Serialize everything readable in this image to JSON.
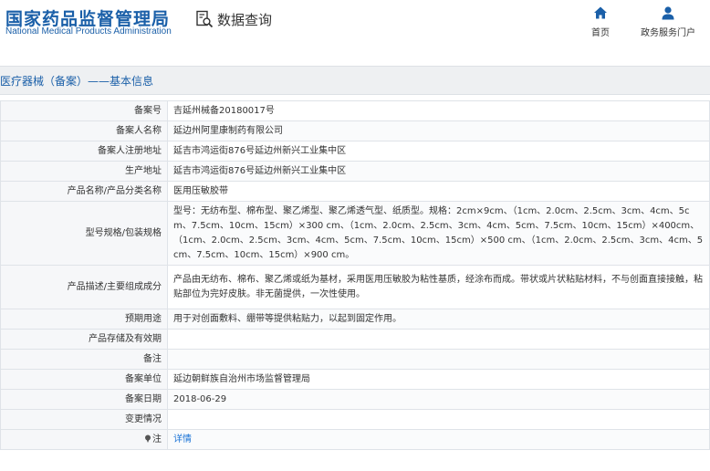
{
  "header": {
    "logo_cn": "国家药品监督管理局",
    "logo_en": "National Medical Products Administration",
    "query_label": "数据查询",
    "nav": [
      {
        "label": "首页",
        "icon": "home-icon"
      },
      {
        "label": "政务服务门户",
        "icon": "user-icon"
      }
    ]
  },
  "page_title": "医疗器械（备案）——基本信息",
  "colors": {
    "brand": "#1a5fa8",
    "link": "#1a73d6",
    "title_bg": "#eef0f2"
  },
  "record": {
    "rows": [
      {
        "label": "备案号",
        "value": "吉延州械备20180017号"
      },
      {
        "label": "备案人名称",
        "value": "延边州阿里康制药有限公司"
      },
      {
        "label": "备案人注册地址",
        "value": "延吉市鸿运街876号延边州新兴工业集中区"
      },
      {
        "label": "生产地址",
        "value": "延吉市鸿运街876号延边州新兴工业集中区"
      },
      {
        "label": "产品名称/产品分类名称",
        "value": "医用压敏胶带"
      },
      {
        "label": "型号规格/包装规格",
        "value": "型号：无纺布型、棉布型、聚乙烯型、聚乙烯透气型、纸质型。规格：2cm×9cm、（1cm、2.0cm、2.5cm、3cm、4cm、5cm、7.5cm、10cm、15cm）×300 cm、（1cm、2.0cm、2.5cm、3cm、4cm、5cm、7.5cm、10cm、15cm）×400cm、（1cm、2.0cm、2.5cm、3cm、4cm、5cm、7.5cm、10cm、15cm）×500 cm、（1cm、2.0cm、2.5cm、3cm、4cm、5cm、7.5cm、10cm、15cm）×900 cm。"
      },
      {
        "label": "产品描述/主要组成成分",
        "value": "产品由无纺布、棉布、聚乙烯或纸为基材，采用医用压敏胶为粘性基质，经涂布而成。带状或片状粘贴材料，不与创面直接接触，粘贴部位为完好皮肤。非无菌提供，一次性使用。"
      },
      {
        "label": "预期用途",
        "value": "用于对创面敷料、绷带等提供粘贴力，以起到固定作用。"
      },
      {
        "label": "产品存储及有效期",
        "value": ""
      },
      {
        "label": "备注",
        "value": ""
      },
      {
        "label": "备案单位",
        "value": "延边朝鲜族自治州市场监督管理局"
      },
      {
        "label": "备案日期",
        "value": "2018-06-29"
      },
      {
        "label": "变更情况",
        "value": ""
      }
    ],
    "note_row": {
      "label": "注",
      "icon": "pin-icon",
      "link": "详情"
    }
  }
}
